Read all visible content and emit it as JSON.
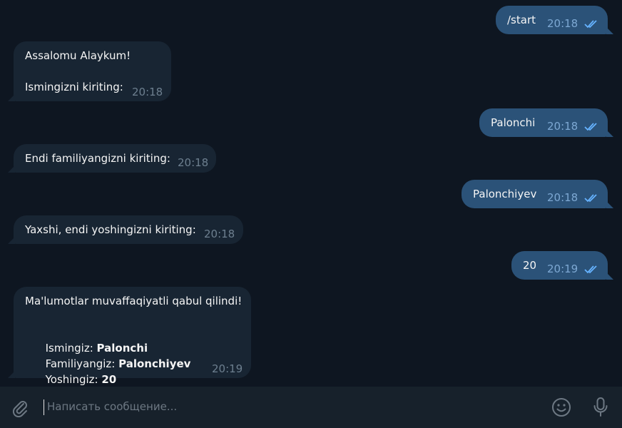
{
  "messages": [
    {
      "dir": "out",
      "text": "/start",
      "time": "20:18",
      "read": true
    },
    {
      "dir": "in",
      "text": "Assalomu Alaykum!\n\nIsmingizni kiriting:",
      "time": "20:18"
    },
    {
      "dir": "out",
      "text": "Palonchi",
      "time": "20:18",
      "read": true
    },
    {
      "dir": "in",
      "text": "Endi familiyangizni kiriting:",
      "time": "20:18"
    },
    {
      "dir": "out",
      "text": "Palonchiyev",
      "time": "20:18",
      "read": true
    },
    {
      "dir": "in",
      "text": "Yaxshi, endi yoshingizni kiriting:",
      "time": "20:18"
    },
    {
      "dir": "out",
      "text": "20",
      "time": "20:19",
      "read": true
    },
    {
      "dir": "in",
      "time": "20:19",
      "header": "Ma'lumotlar muvaffaqiyatli qabul qilindi!",
      "fields": [
        {
          "label": "Ismingiz: ",
          "value": "Palonchi"
        },
        {
          "label": "Familiyangiz: ",
          "value": "Palonchiyev"
        },
        {
          "label": "Yoshingiz: ",
          "value": "20"
        }
      ]
    }
  ],
  "composer": {
    "placeholder": "Написать сообщение...",
    "attach_icon": "paperclip-icon",
    "emoji_icon": "smile-icon",
    "voice_icon": "microphone-icon"
  },
  "colors": {
    "background": "#0e1621",
    "incoming": "#182533",
    "outgoing": "#2b5278",
    "composer": "#17212b",
    "read_ticks": "#66b3ff"
  }
}
